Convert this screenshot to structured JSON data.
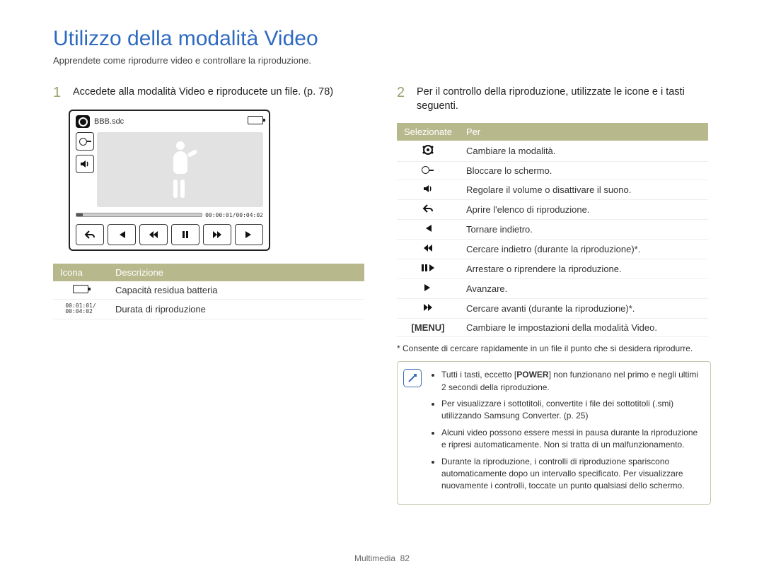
{
  "title": "Utilizzo della modalità Video",
  "subtitle": "Apprendete come riprodurre video e controllare la riproduzione.",
  "step1": {
    "num": "1",
    "text": "Accedete alla modalità Video e riproducete un file. (p. 78)"
  },
  "step2": {
    "num": "2",
    "text": "Per il controllo della riproduzione, utilizzate le icone e i tasti seguenti."
  },
  "player": {
    "filename": "BBB.sdc",
    "timecode": "00:00:01/00:04:02"
  },
  "table1": {
    "headers": [
      "Icona",
      "Descrizione"
    ],
    "rows": [
      {
        "icon": "battery",
        "desc": "Capacità residua batteria"
      },
      {
        "icon": "duration",
        "desc": "Durata di riproduzione",
        "duration_top": "00:01:01/",
        "duration_bottom": "00:04:02"
      }
    ]
  },
  "table2": {
    "headers": [
      "Selezionate",
      "Per"
    ],
    "rows": [
      {
        "icon": "mode",
        "desc": "Cambiare la modalità."
      },
      {
        "icon": "lock",
        "desc": "Bloccare lo schermo."
      },
      {
        "icon": "volume",
        "desc": "Regolare il volume o disattivare il suono."
      },
      {
        "icon": "back",
        "desc": "Aprire l'elenco di riproduzione."
      },
      {
        "icon": "prev",
        "desc": "Tornare indietro."
      },
      {
        "icon": "rew",
        "desc": "Cercare indietro (durante la riproduzione)*."
      },
      {
        "icon": "playpause",
        "desc": "Arrestare o riprendere la riproduzione."
      },
      {
        "icon": "next",
        "desc": "Avanzare."
      },
      {
        "icon": "ffw",
        "desc": "Cercare avanti (durante la riproduzione)*."
      },
      {
        "icon": "menu",
        "label": "[MENU]",
        "desc": "Cambiare le impostazioni della modalità Video."
      }
    ]
  },
  "footnote": "* Consente di cercare rapidamente in un file il punto che si desidera riprodurre.",
  "tips": [
    {
      "pre": "Tutti i tasti, eccetto [",
      "bold": "POWER",
      "post": "] non funzionano nel primo e negli ultimi 2 secondi della riproduzione."
    },
    {
      "text": "Per visualizzare i sottotitoli, convertite i file dei sottotitoli (.smi) utilizzando Samsung Converter. (p. 25)"
    },
    {
      "text": "Alcuni video possono essere messi in pausa durante la riproduzione e ripresi automaticamente. Non si tratta di un malfunzionamento."
    },
    {
      "text": "Durante la riproduzione, i controlli di riproduzione spariscono automaticamente dopo un intervallo specificato. Per visualizzare nuovamente i controlli, toccate un punto qualsiasi dello schermo."
    }
  ],
  "footer": {
    "section": "Multimedia",
    "page": "82"
  }
}
